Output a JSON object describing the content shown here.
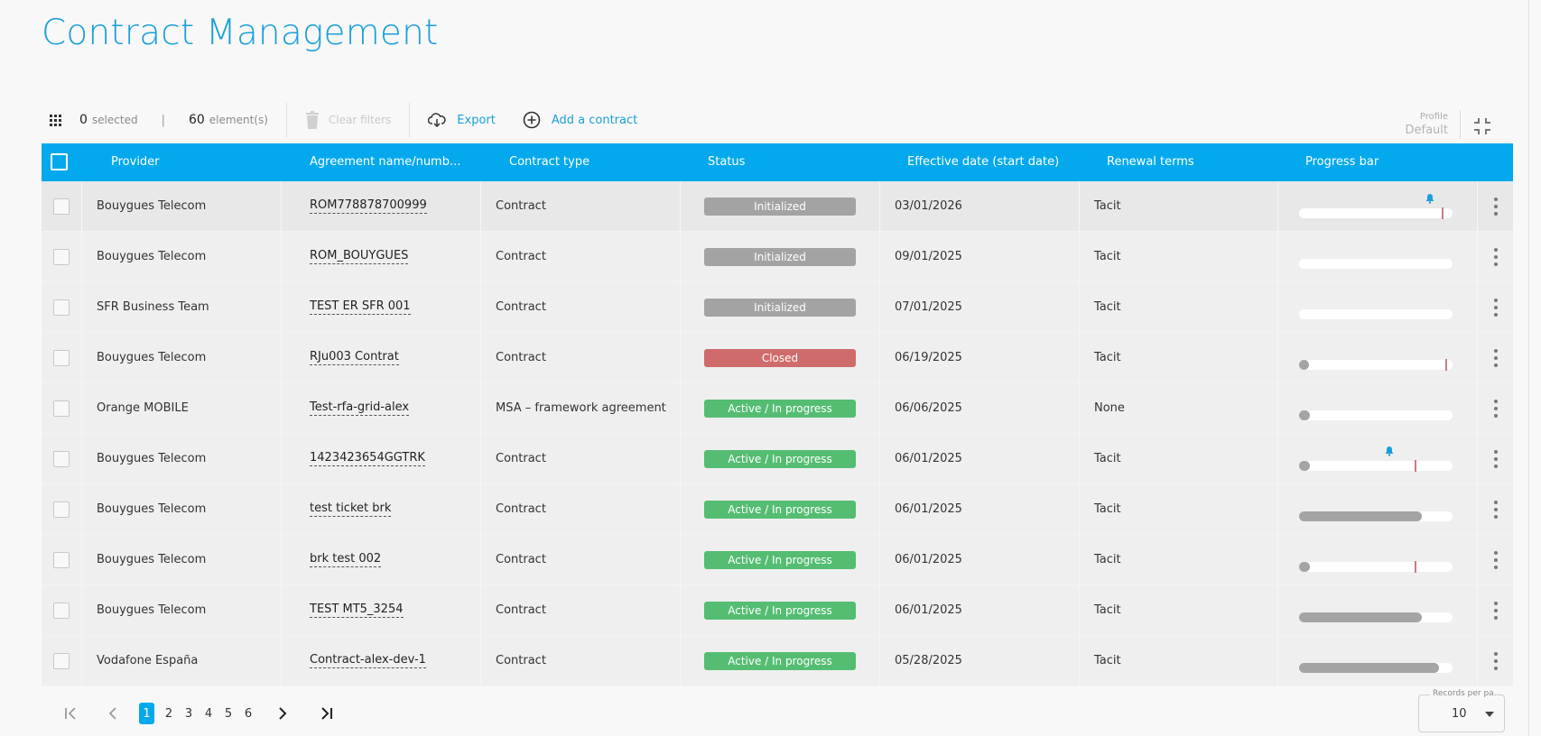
{
  "page": {
    "title": "Contract Management"
  },
  "toolbar": {
    "selected_count": "0",
    "selected_label": "selected",
    "separator": "|",
    "element_count": "60",
    "element_label": "element(s)",
    "clear_filters": "Clear filters",
    "export": "Export",
    "add_contract": "Add a contract",
    "profile_label": "Profile",
    "profile_value": "Default"
  },
  "columns": [
    "Provider",
    "Agreement name/numb...",
    "Contract type",
    "Status",
    "Effective date (start date)",
    "Renewal terms",
    "Progress bar"
  ],
  "colors": {
    "header": "#03a9ec",
    "accent": "#1a9fd8",
    "status_initialized": "#a3a3a3",
    "status_closed": "#cf6b6b",
    "status_active": "#54bd72"
  },
  "rows": [
    {
      "provider": "Bouygues Telecom",
      "agreement": "ROM778878700999",
      "type": "Contract",
      "status": "Initialized",
      "status_kind": "init",
      "date": "03/01/2026",
      "renewal": "Tacit",
      "progress": 0,
      "marker": 0.93,
      "bell": 0.85
    },
    {
      "provider": "Bouygues Telecom",
      "agreement": "ROM_BOUYGUES",
      "type": "Contract",
      "status": "Initialized",
      "status_kind": "init",
      "date": "09/01/2025",
      "renewal": "Tacit",
      "progress": 0,
      "marker": null,
      "bell": null
    },
    {
      "provider": "SFR Business Team",
      "agreement": "TEST ER SFR 001",
      "type": "Contract",
      "status": "Initialized",
      "status_kind": "init",
      "date": "07/01/2025",
      "renewal": "Tacit",
      "progress": 0,
      "marker": null,
      "bell": null
    },
    {
      "provider": "Bouygues Telecom",
      "agreement": "RJu003 Contrat",
      "type": "Contract",
      "status": "Closed",
      "status_kind": "closed",
      "date": "06/19/2025",
      "renewal": "Tacit",
      "progress": 0.01,
      "marker": 0.95,
      "bell": null
    },
    {
      "provider": "Orange MOBILE",
      "agreement": "Test-rfa-grid-alex",
      "type": "MSA – framework agreement",
      "status": "Active / In progress",
      "status_kind": "active",
      "date": "06/06/2025",
      "renewal": "None",
      "progress": 0.07,
      "marker": null,
      "bell": null
    },
    {
      "provider": "Bouygues Telecom",
      "agreement": "1423423654GGTRK",
      "type": "Contract",
      "status": "Active / In progress",
      "status_kind": "active",
      "date": "06/01/2025",
      "renewal": "Tacit",
      "progress": 0.07,
      "marker": 0.75,
      "bell": 0.59
    },
    {
      "provider": "Bouygues Telecom",
      "agreement": "test ticket brk",
      "type": "Contract",
      "status": "Active / In progress",
      "status_kind": "active",
      "date": "06/01/2025",
      "renewal": "Tacit",
      "progress": 0.8,
      "marker": null,
      "bell": null
    },
    {
      "provider": "Bouygues Telecom",
      "agreement": "brk test 002",
      "type": "Contract",
      "status": "Active / In progress",
      "status_kind": "active",
      "date": "06/01/2025",
      "renewal": "Tacit",
      "progress": 0.07,
      "marker": 0.75,
      "bell": null
    },
    {
      "provider": "Bouygues Telecom",
      "agreement": "TEST MT5_3254",
      "type": "Contract",
      "status": "Active / In progress",
      "status_kind": "active",
      "date": "06/01/2025",
      "renewal": "Tacit",
      "progress": 0.8,
      "marker": null,
      "bell": null
    },
    {
      "provider": "Vodafone España",
      "agreement": "Contract-alex-dev-1",
      "type": "Contract",
      "status": "Active / In progress",
      "status_kind": "active",
      "date": "05/28/2025",
      "renewal": "Tacit",
      "progress": 0.91,
      "marker": null,
      "bell": null
    }
  ],
  "pagination": {
    "pages": [
      "1",
      "2",
      "3",
      "4",
      "5",
      "6"
    ],
    "current": "1"
  },
  "records_per_page": {
    "label": "Records per pa...",
    "value": "10"
  }
}
